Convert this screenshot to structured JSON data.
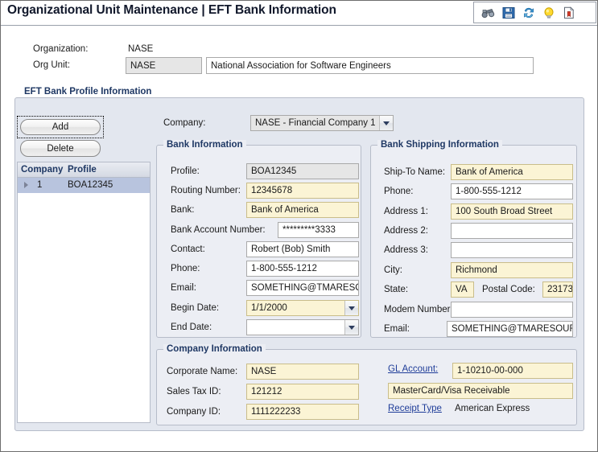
{
  "header": {
    "title": "Organizational Unit Maintenance | EFT Bank Information",
    "toolbar_icons": [
      {
        "name": "binoculars-icon",
        "label": "Find"
      },
      {
        "name": "save-icon",
        "label": "Save"
      },
      {
        "name": "refresh-icon",
        "label": "Refresh"
      },
      {
        "name": "lightbulb-icon",
        "label": "Hint"
      },
      {
        "name": "report-icon",
        "label": "Report"
      }
    ]
  },
  "org": {
    "organization_label": "Organization:",
    "organization_value": "NASE",
    "org_unit_label": "Org Unit:",
    "org_unit_code": "NASE",
    "org_unit_name": "National Association for Software Engineers"
  },
  "eft_group": {
    "title": "EFT Bank Profile Information",
    "add_label": "Add",
    "delete_label": "Delete",
    "grid": {
      "columns": [
        "Company",
        "Profile"
      ],
      "rows": [
        {
          "company": "1",
          "profile": "BOA12345"
        }
      ]
    },
    "company_label": "Company:",
    "company_value": "NASE - Financial Company 1"
  },
  "bank_information": {
    "title": "Bank Information",
    "fields": [
      {
        "label": "Profile:",
        "value": "BOA12345"
      },
      {
        "label": "Routing Number:",
        "value": "12345678"
      },
      {
        "label": "Bank:",
        "value": "Bank of America"
      },
      {
        "label": "Bank Account Number:",
        "value": "*********3333"
      },
      {
        "label": "Contact:",
        "value": "Robert (Bob) Smith"
      },
      {
        "label": "Phone:",
        "value": "1-800-555-1212"
      },
      {
        "label": "Email:",
        "value": "SOMETHING@TMARESOURCE.COM"
      },
      {
        "label": "Begin Date:",
        "value": "1/1/2000"
      },
      {
        "label": "End Date:",
        "value": ""
      }
    ]
  },
  "bank_shipping_information": {
    "title": "Bank Shipping Information",
    "fields": [
      {
        "label": "Ship-To Name:",
        "value": "Bank of America"
      },
      {
        "label": "Phone:",
        "value": "1-800-555-1212"
      },
      {
        "label": "Address 1:",
        "value": "100 South Broad Street"
      },
      {
        "label": "Address 2:",
        "value": ""
      },
      {
        "label": "Address 3:",
        "value": ""
      },
      {
        "label": "City:",
        "value": "Richmond"
      },
      {
        "label": "State:",
        "value": "VA"
      },
      {
        "label": "Postal Code:",
        "value": "23173"
      },
      {
        "label": "Modem Number:",
        "value": ""
      },
      {
        "label": "Email:",
        "value": "SOMETHING@TMARESOURCE.COM"
      }
    ]
  },
  "company_information": {
    "title": "Company Information",
    "corporate_name_label": "Corporate Name:",
    "corporate_name_value": "NASE",
    "sales_tax_id_label": "Sales Tax ID:",
    "sales_tax_id_value": "121212",
    "company_id_label": "Company ID:",
    "company_id_value": "1111222233",
    "gl_account_label": "GL Account:",
    "gl_account_value": "1-10210-00-000",
    "gl_account_description": "MasterCard/Visa Receivable",
    "receipt_type_label": "Receipt Type",
    "receipt_type_value": "American Express"
  },
  "colors": {
    "accent": "#1f3864",
    "link": "#1f3d99",
    "required_field": "#fbf4d5",
    "disabled_field": "#e6e6e6",
    "grid_selection": "#b8c4de",
    "panel_background": "#eceef4"
  }
}
